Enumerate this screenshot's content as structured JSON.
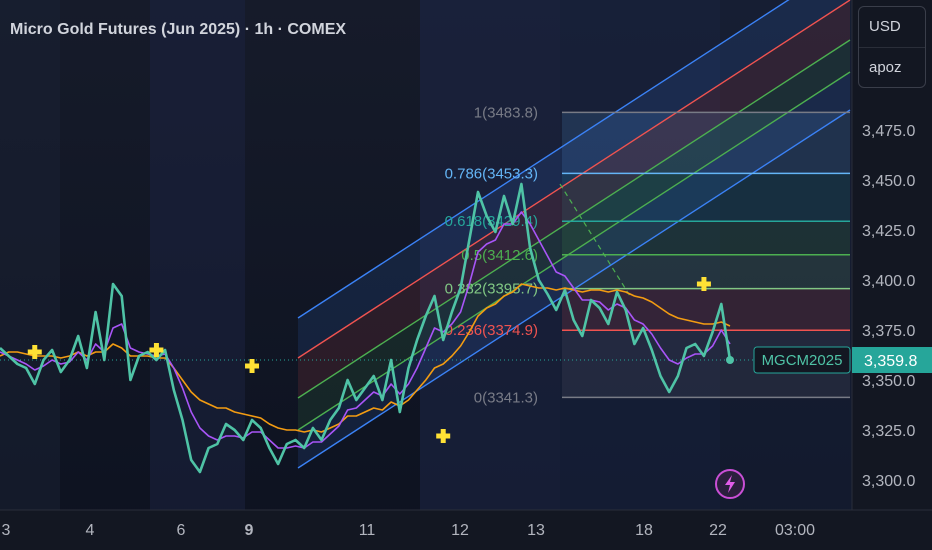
{
  "header": {
    "title": "Micro Gold Futures (Jun 2025) · 1h · COMEX"
  },
  "unit_menu": {
    "currency": "USD",
    "unit": "apoz"
  },
  "colors": {
    "background": "#131722",
    "price_line": "#4fc3a6",
    "ma_orange": "#f39c12",
    "ma_purple": "#a855f7",
    "marker": "#ffe135",
    "label_bg": "#26a69a",
    "axis_text": "#b2b5be"
  },
  "icons": {
    "alert": "lightning-icon"
  },
  "chart_data": {
    "type": "line",
    "title": "Micro Gold Futures (Jun 2025) · 1h · COMEX",
    "xlabel": "",
    "ylabel": "",
    "ylim": [
      3290,
      3500
    ],
    "y_ticks": [
      "3,300.0",
      "3,325.0",
      "3,350.0",
      "3,375.0",
      "3,400.0",
      "3,425.0",
      "3,450.0",
      "3,475.0"
    ],
    "x_ticks": [
      "3",
      "4",
      "6",
      "9",
      "11",
      "12",
      "13",
      "18",
      "22",
      "03:00"
    ],
    "last_price": {
      "symbol": "MGCM2025",
      "value": "3,359.8"
    },
    "grid": false,
    "series": [
      {
        "key": "price",
        "values": [
          3366,
          3362,
          3358,
          3356,
          3348,
          3360,
          3365,
          3354,
          3360,
          3372,
          3356,
          3384,
          3360,
          3398,
          3392,
          3350,
          3362,
          3364,
          3360,
          3365,
          3345,
          3330,
          3310,
          3304,
          3316,
          3318,
          3328,
          3325,
          3320,
          3330,
          3326,
          3316,
          3308,
          3318,
          3320,
          3316,
          3326,
          3320,
          3330,
          3336,
          3350,
          3340,
          3346,
          3352,
          3340,
          3360,
          3334,
          3356,
          3370,
          3382,
          3392,
          3370,
          3384,
          3396,
          3420,
          3444,
          3432,
          3424,
          3442,
          3428,
          3448,
          3416,
          3400,
          3393,
          3385,
          3395,
          3380,
          3372,
          3390,
          3386,
          3378,
          3394,
          3385,
          3368,
          3376,
          3365,
          3352,
          3344,
          3352,
          3366,
          3368,
          3362,
          3374,
          3388,
          3360
        ]
      },
      {
        "key": "ma_orange",
        "values": [
          3362,
          3364,
          3364,
          3363,
          3362,
          3362,
          3362,
          3361,
          3362,
          3364,
          3362,
          3364,
          3364,
          3368,
          3366,
          3362,
          3362,
          3362,
          3361,
          3361,
          3356,
          3350,
          3344,
          3340,
          3338,
          3336,
          3336,
          3334,
          3333,
          3332,
          3331,
          3328,
          3326,
          3325,
          3325,
          3324,
          3325,
          3324,
          3326,
          3328,
          3332,
          3332,
          3334,
          3336,
          3335,
          3339,
          3337,
          3340,
          3345,
          3350,
          3356,
          3358,
          3362,
          3367,
          3374,
          3382,
          3386,
          3388,
          3392,
          3394,
          3398,
          3397,
          3396,
          3396,
          3395,
          3396,
          3395,
          3394,
          3395,
          3395,
          3394,
          3395,
          3394,
          3392,
          3391,
          3389,
          3386,
          3383,
          3381,
          3380,
          3379,
          3378,
          3378,
          3379,
          3377
        ]
      },
      {
        "key": "ma_purple",
        "values": [
          3364,
          3362,
          3360,
          3358,
          3355,
          3357,
          3360,
          3358,
          3359,
          3364,
          3360,
          3368,
          3364,
          3376,
          3378,
          3366,
          3364,
          3363,
          3362,
          3363,
          3356,
          3346,
          3334,
          3326,
          3322,
          3320,
          3322,
          3322,
          3321,
          3324,
          3324,
          3320,
          3316,
          3316,
          3317,
          3316,
          3319,
          3319,
          3323,
          3327,
          3335,
          3336,
          3340,
          3344,
          3342,
          3348,
          3343,
          3348,
          3356,
          3366,
          3376,
          3374,
          3378,
          3384,
          3398,
          3414,
          3418,
          3420,
          3428,
          3428,
          3434,
          3428,
          3420,
          3412,
          3404,
          3402,
          3396,
          3390,
          3390,
          3389,
          3385,
          3388,
          3386,
          3380,
          3378,
          3373,
          3366,
          3360,
          3358,
          3361,
          3363,
          3363,
          3367,
          3375,
          3368
        ]
      }
    ],
    "cross_markers": [
      {
        "index": 4,
        "value": 3364
      },
      {
        "index": 18,
        "value": 3365
      },
      {
        "index": 29,
        "value": 3357
      },
      {
        "index": 51,
        "value": 3322
      },
      {
        "index": 81,
        "value": 3398
      }
    ],
    "fib_levels": [
      {
        "label": "1(3483.8)",
        "value": 3483.8,
        "color": "#787b86"
      },
      {
        "label": "0.786(3453.3)",
        "value": 3453.3,
        "color": "#64b5f6"
      },
      {
        "label": "0.618(3429.4)",
        "value": 3429.4,
        "color": "#26a69a"
      },
      {
        "label": "0.5(3412.6)",
        "value": 3412.6,
        "color": "#4caf50"
      },
      {
        "label": "0.382(3395.7)",
        "value": 3395.7,
        "color": "#81c784"
      },
      {
        "label": "0.236(3374.9)",
        "value": 3374.9,
        "color": "#f05350"
      },
      {
        "label": "0(3341.3)",
        "value": 3341.3,
        "color": "#787b86"
      }
    ]
  }
}
